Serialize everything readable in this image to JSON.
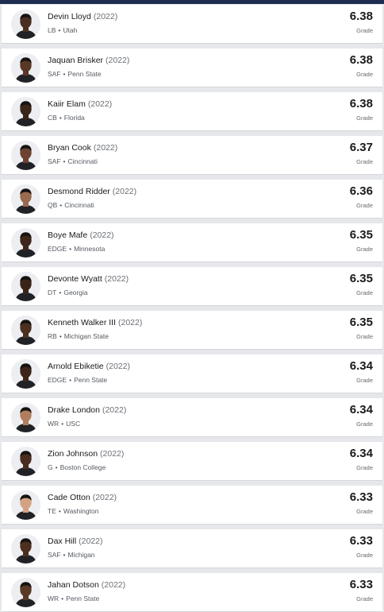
{
  "header_bar": {
    "color": "#1d2d52"
  },
  "players": [
    {
      "name": "Devin Lloyd",
      "year": "(2022)",
      "position": "LB",
      "school": "Utah",
      "grade": "6.38",
      "grade_label": "Grade",
      "skin": "#4a2e1f"
    },
    {
      "name": "Jaquan Brisker",
      "year": "(2022)",
      "position": "SAF",
      "school": "Penn State",
      "grade": "6.38",
      "grade_label": "Grade",
      "skin": "#5a3826"
    },
    {
      "name": "Kaiir Elam",
      "year": "(2022)",
      "position": "CB",
      "school": "Florida",
      "grade": "6.38",
      "grade_label": "Grade",
      "skin": "#3b2519"
    },
    {
      "name": "Bryan Cook",
      "year": "(2022)",
      "position": "SAF",
      "school": "Cincinnati",
      "grade": "6.37",
      "grade_label": "Grade",
      "skin": "#6b4330"
    },
    {
      "name": "Desmond Ridder",
      "year": "(2022)",
      "position": "QB",
      "school": "Cincinnati",
      "grade": "6.36",
      "grade_label": "Grade",
      "skin": "#9a6a4f"
    },
    {
      "name": "Boye Mafe",
      "year": "(2022)",
      "position": "EDGE",
      "school": "Minnesota",
      "grade": "6.35",
      "grade_label": "Grade",
      "skin": "#3e261a"
    },
    {
      "name": "Devonte Wyatt",
      "year": "(2022)",
      "position": "DT",
      "school": "Georgia",
      "grade": "6.35",
      "grade_label": "Grade",
      "skin": "#3a2418"
    },
    {
      "name": "Kenneth Walker III",
      "year": "(2022)",
      "position": "RB",
      "school": "Michigan State",
      "grade": "6.35",
      "grade_label": "Grade",
      "skin": "#4b2f20"
    },
    {
      "name": "Arnold Ebiketie",
      "year": "(2022)",
      "position": "EDGE",
      "school": "Penn State",
      "grade": "6.34",
      "grade_label": "Grade",
      "skin": "#3d2619"
    },
    {
      "name": "Drake London",
      "year": "(2022)",
      "position": "WR",
      "school": "USC",
      "grade": "6.34",
      "grade_label": "Grade",
      "skin": "#b07e5e"
    },
    {
      "name": "Zion Johnson",
      "year": "(2022)",
      "position": "G",
      "school": "Boston College",
      "grade": "6.34",
      "grade_label": "Grade",
      "skin": "#4a2d1e"
    },
    {
      "name": "Cade Otton",
      "year": "(2022)",
      "position": "TE",
      "school": "Washington",
      "grade": "6.33",
      "grade_label": "Grade",
      "skin": "#d2a283"
    },
    {
      "name": "Dax Hill",
      "year": "(2022)",
      "position": "SAF",
      "school": "Michigan",
      "grade": "6.33",
      "grade_label": "Grade",
      "skin": "#4d2f1f"
    },
    {
      "name": "Jahan Dotson",
      "year": "(2022)",
      "position": "WR",
      "school": "Penn State",
      "grade": "6.33",
      "grade_label": "Grade",
      "skin": "#5b3927"
    }
  ],
  "separator": "•"
}
